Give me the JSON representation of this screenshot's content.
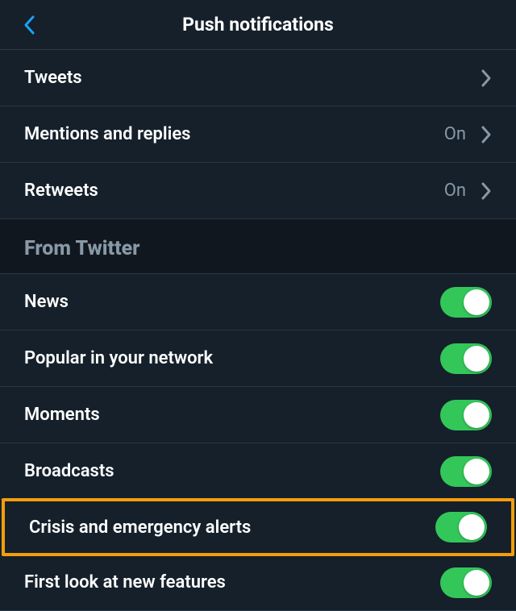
{
  "header": {
    "title": "Push notifications"
  },
  "rows": {
    "tweets": {
      "label": "Tweets"
    },
    "mentions": {
      "label": "Mentions and replies",
      "value": "On"
    },
    "retweets": {
      "label": "Retweets",
      "value": "On"
    }
  },
  "section": {
    "from_twitter": "From Twitter"
  },
  "toggles": {
    "news": {
      "label": "News",
      "on": true
    },
    "popular": {
      "label": "Popular in your network",
      "on": true
    },
    "moments": {
      "label": "Moments",
      "on": true
    },
    "broadcasts": {
      "label": "Broadcasts",
      "on": true
    },
    "crisis": {
      "label": "Crisis and emergency alerts",
      "on": true
    },
    "firstlook": {
      "label": "First look at new features",
      "on": true
    }
  },
  "colors": {
    "background": "#15202b",
    "divider": "#28374a",
    "secondary_text": "#8899a6",
    "toggle_on": "#33c75a",
    "back_arrow": "#1da1f2",
    "highlight": "#f59e0b"
  }
}
